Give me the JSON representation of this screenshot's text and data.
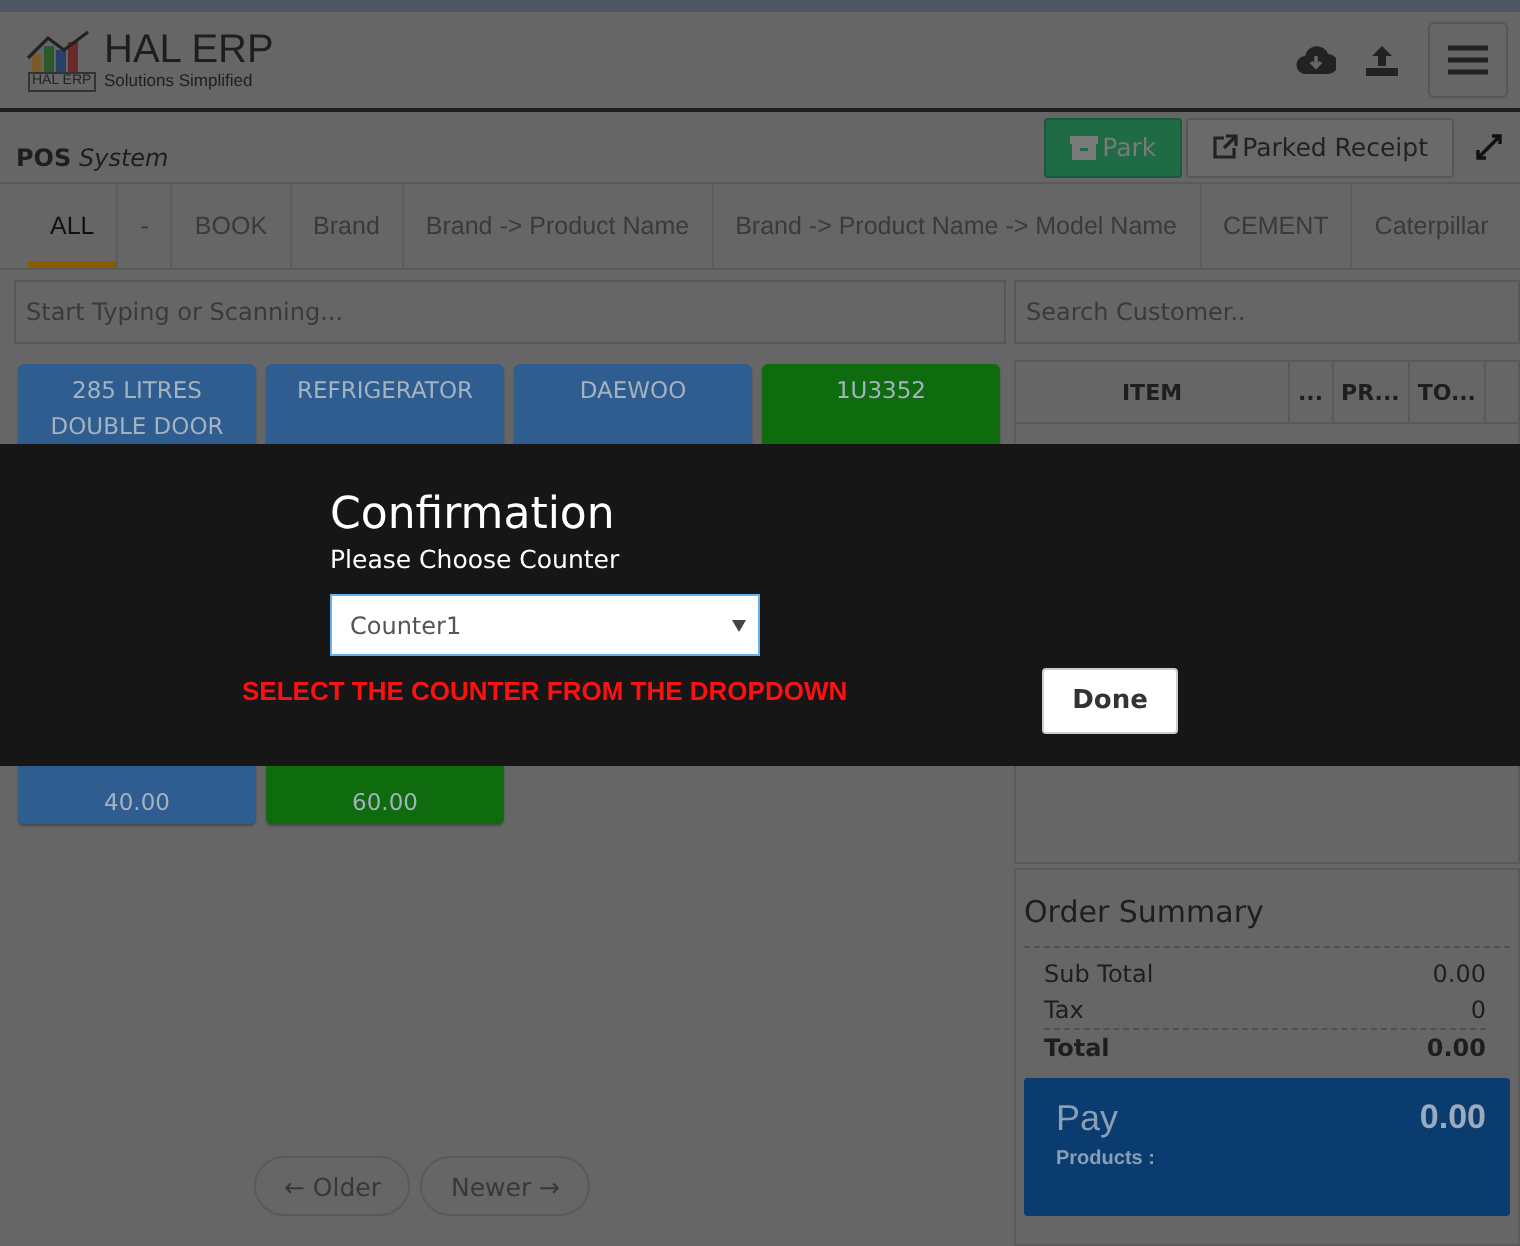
{
  "header": {
    "logo": {
      "badge": "HAL ERP",
      "title": "HAL ERP",
      "tagline": "Solutions Simplified"
    }
  },
  "pos_bar": {
    "title": "**POS** *System*",
    "buttons": [
      {
        "kind": "park",
        "label": "Park"
      },
      {
        "kind": "receipt",
        "label": "Parked Receipt"
      }
    ]
  },
  "tabs": [
    {
      "label": "ALL",
      "selected": true
    },
    {
      "label": "-",
      "selected": false
    },
    {
      "label": "BOOK",
      "selected": false
    },
    {
      "label": "Brand",
      "selected": false
    },
    {
      "label": "Brand -> Product Name",
      "selected": false
    },
    {
      "label": "Brand -> Product Name -> Model Name",
      "selected": false
    },
    {
      "label": "CEMENT",
      "selected": false
    },
    {
      "label": "Caterpillar",
      "selected": false
    }
  ],
  "product_search": {
    "placeholder": "Start Typing or Scanning..."
  },
  "products": [
    {
      "name": "285 LITRES DOUBLE DOOR",
      "color": "#2f5d8f"
    },
    {
      "name": "REFRIGERATOR",
      "color": "#2f5d8f"
    },
    {
      "name": "DAEWOO",
      "color": "#2f5d8f"
    },
    {
      "name": "1U3352",
      "color": "#0e6b0e"
    },
    {
      "price": "40.00",
      "color": "#2f5d8f"
    },
    {
      "price": "60.00",
      "color": "#0e6b0e"
    }
  ],
  "pager": [
    "← Older",
    "Newer →"
  ],
  "customer_search": {
    "placeholder": "Search Customer.."
  },
  "cart": {
    "columns": [
      "ITEM",
      "...",
      "PR...",
      "TO..."
    ]
  },
  "order_summary": {
    "title": "Order Summary",
    "rows": [
      {
        "label": "Sub Total",
        "value": "0.00",
        "kind": "normal"
      },
      {
        "label": "Tax",
        "value": "0",
        "kind": "normal"
      },
      {
        "label": "Total",
        "value": "0.00",
        "kind": "total"
      }
    ],
    "pay": {
      "label": "Pay",
      "amount": "0.00",
      "products_label": "Products :"
    }
  },
  "dialog": {
    "title": "Confirmation",
    "subtitle": "Please Choose Counter",
    "select_value": "Counter1",
    "error": "SELECT THE COUNTER FROM THE DROPDOWN",
    "button": "Done"
  }
}
